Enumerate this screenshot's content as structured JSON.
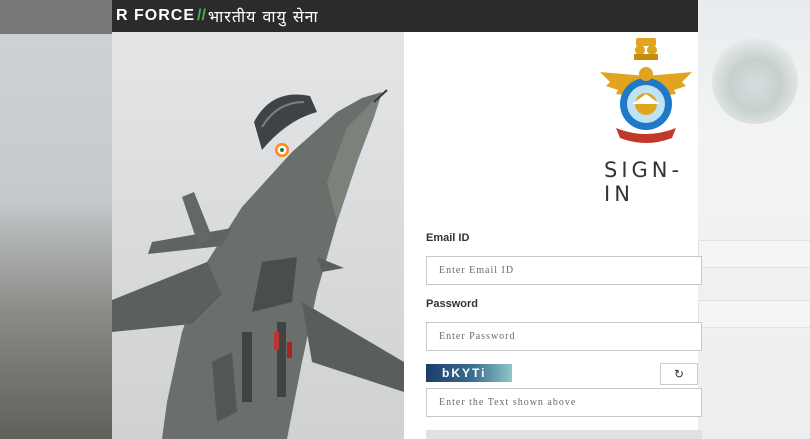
{
  "header": {
    "brand": "R FORCE",
    "slashes": "//",
    "hindi": "भारतीय वायु सेना"
  },
  "login": {
    "title": "SIGN-IN",
    "email": {
      "label": "Email ID",
      "placeholder": "Enter Email ID",
      "value": ""
    },
    "password": {
      "label": "Password",
      "placeholder": "Enter Password",
      "value": ""
    },
    "captcha": {
      "text": "bKYTi",
      "refresh_icon": "refresh-icon",
      "placeholder": "Enter the Text shown above",
      "value": ""
    }
  },
  "colors": {
    "header_bg": "#2b2b2b",
    "accent_green": "#4caf50",
    "emblem_blue": "#1f78c8",
    "emblem_gold": "#e0a420",
    "emblem_red": "#c0392b"
  },
  "icons": {
    "emblem": "air-force-emblem",
    "photo": "fighter-jet-photo"
  }
}
